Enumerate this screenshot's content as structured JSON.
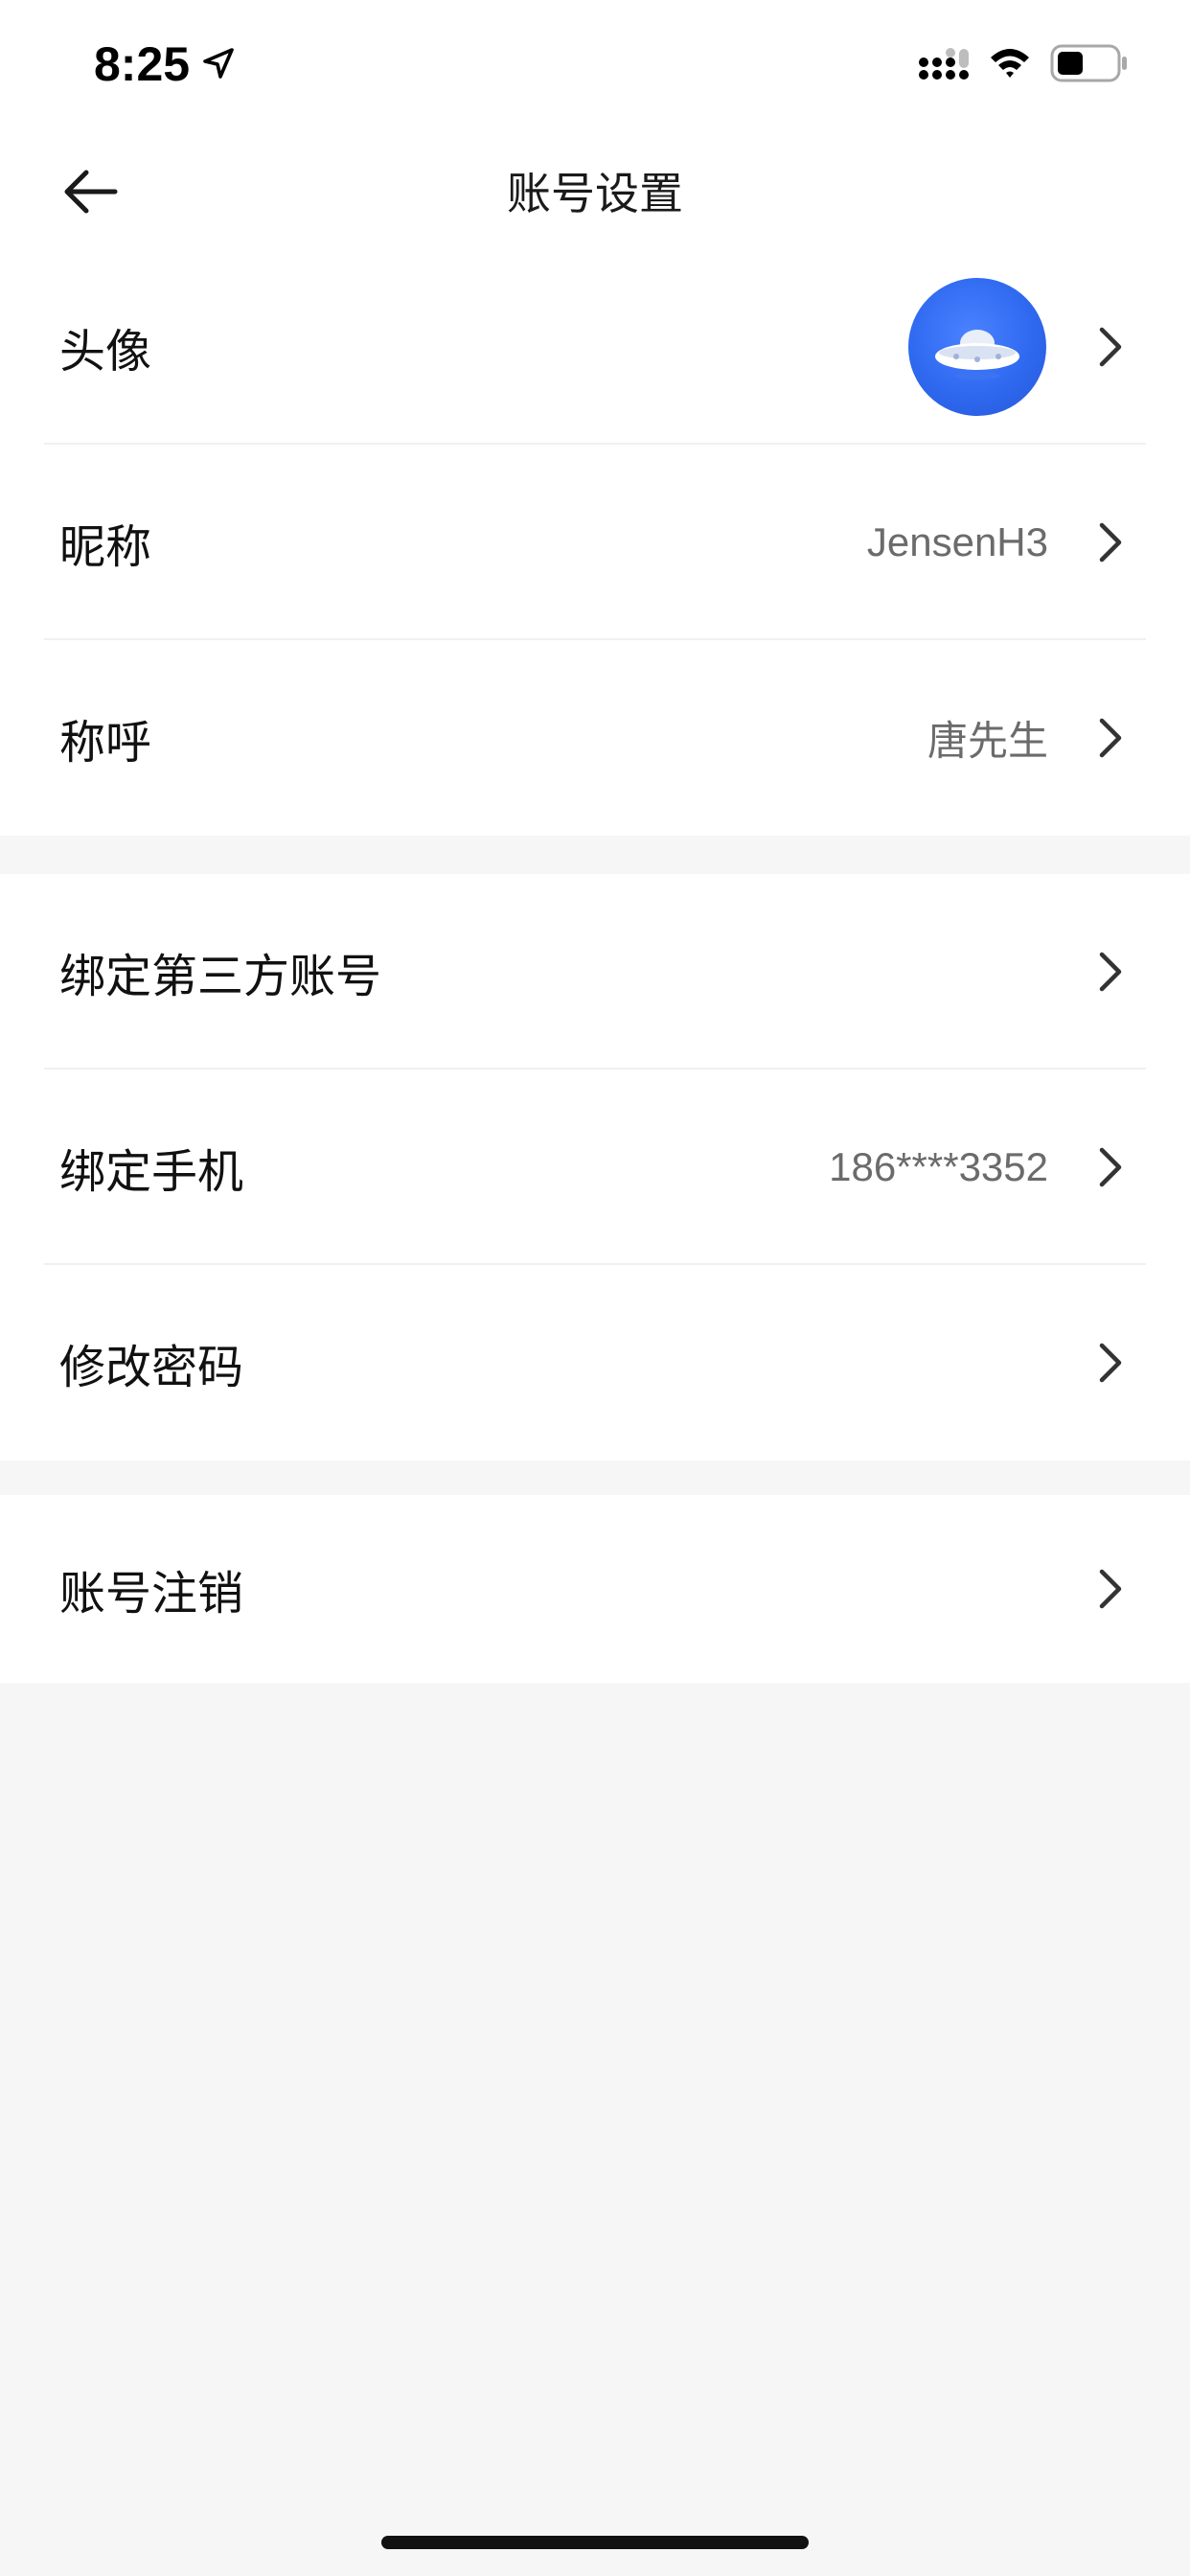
{
  "status_bar": {
    "time": "8:25"
  },
  "nav": {
    "title": "账号设置"
  },
  "groups": [
    {
      "rows": [
        {
          "label": "头像",
          "value": ""
        },
        {
          "label": "昵称",
          "value": "JensenH3"
        },
        {
          "label": "称呼",
          "value": "唐先生"
        }
      ]
    },
    {
      "rows": [
        {
          "label": "绑定第三方账号",
          "value": ""
        },
        {
          "label": "绑定手机",
          "value": "186****3352"
        },
        {
          "label": "修改密码",
          "value": ""
        }
      ]
    },
    {
      "rows": [
        {
          "label": "账号注销",
          "value": ""
        }
      ]
    }
  ],
  "colors": {
    "background": "#f6f6f6",
    "surface": "#ffffff",
    "avatar_blue": "#2f69f0",
    "value_gray": "#6b6b6b"
  },
  "icons": [
    "location-arrow-icon",
    "signal-icon",
    "wifi-icon",
    "battery-icon",
    "back-arrow-icon",
    "chevron-right-icon",
    "ufo-avatar-icon"
  ]
}
